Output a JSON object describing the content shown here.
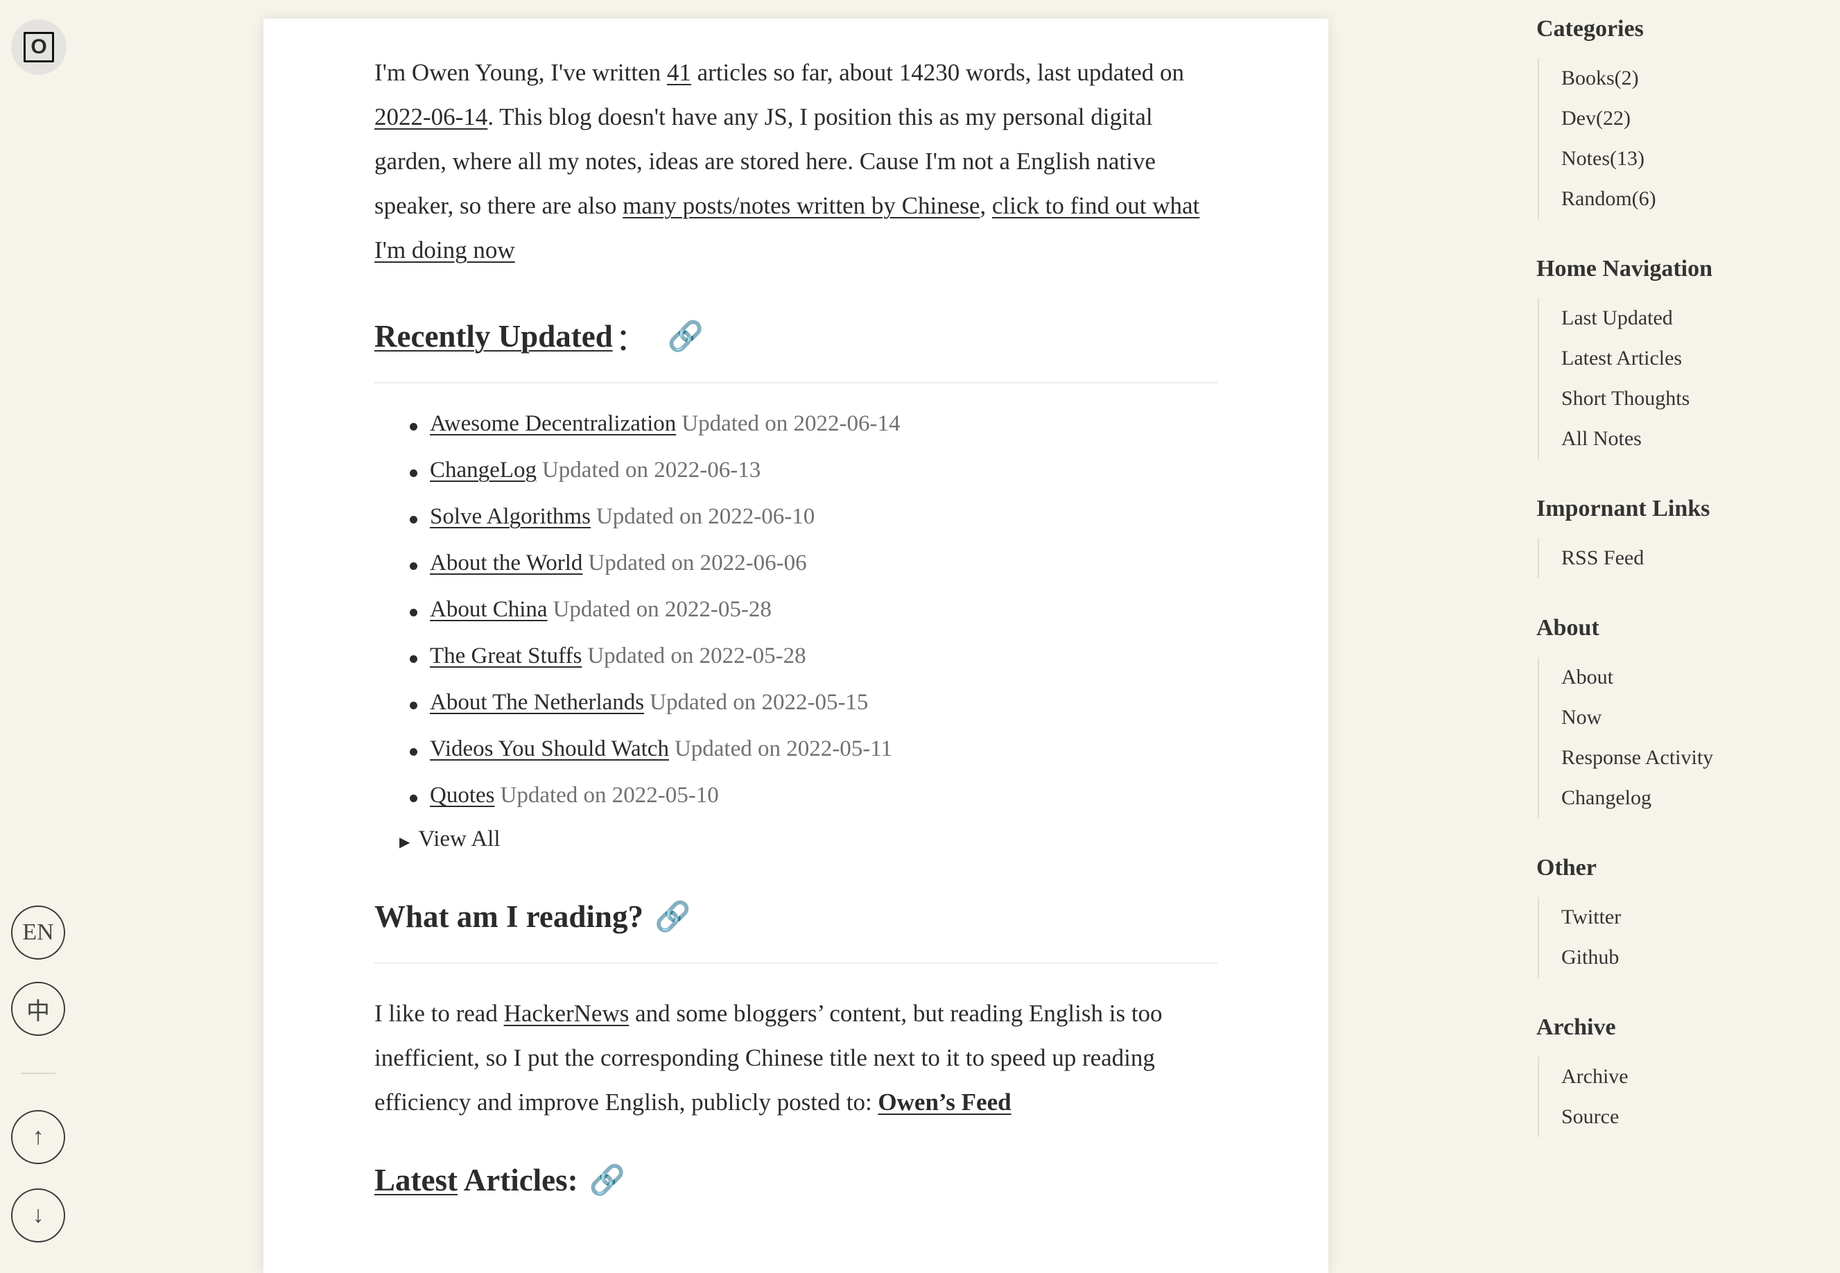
{
  "rail": {
    "lang_en": "EN",
    "lang_zh": "中",
    "up": "↑",
    "down": "↓",
    "logo_glyph": "O"
  },
  "intro": {
    "p1": "I'm Owen Young, I've written ",
    "articles_count": "41",
    "p2": " articles so far, about 14230 words, last updated on ",
    "last_updated": "2022-06-14",
    "p3": ". This blog doesn't have any JS, I position this as my personal digital garden, where all my notes, ideas are stored here. Cause I'm not a English native speaker, so there are also ",
    "chinese_link": "many posts/notes written by Chinese",
    "p4": ", ",
    "now_link": "click to find out what I'm doing now"
  },
  "recently_updated": {
    "title": "Recently Updated",
    "colon": "：",
    "link_icon": "🔗",
    "items": [
      {
        "title": "Awesome Decentralization",
        "date": "Updated on 2022-06-14"
      },
      {
        "title": "ChangeLog",
        "date": "Updated on 2022-06-13"
      },
      {
        "title": "Solve Algorithms",
        "date": "Updated on 2022-06-10"
      },
      {
        "title": "About the World",
        "date": "Updated on 2022-06-06"
      },
      {
        "title": "About China",
        "date": "Updated on 2022-05-28"
      },
      {
        "title": "The Great Stuffs",
        "date": "Updated on 2022-05-28"
      },
      {
        "title": "About The Netherlands",
        "date": "Updated on 2022-05-15"
      },
      {
        "title": "Videos You Should Watch",
        "date": "Updated on 2022-05-11"
      },
      {
        "title": "Quotes",
        "date": "Updated on 2022-05-10"
      }
    ],
    "view_all": "View All",
    "view_all_icon": "▶"
  },
  "reading": {
    "title": "What am I reading?",
    "link_icon": "🔗",
    "p1": "I like to read ",
    "hn_link": "HackerNews",
    "p2": " and some bloggers’ content, but reading English is too inefficient, so I put the corresponding Chinese title next to it to speed up reading efficiency and improve English, publicly posted to: ",
    "feed_link": "Owen’s Feed"
  },
  "latest": {
    "title_link": "Latest",
    "title_rest": " Articles:",
    "link_icon": "🔗"
  },
  "sidebar": {
    "groups": [
      {
        "title": "Categories",
        "items": [
          "Books(2)",
          "Dev(22)",
          "Notes(13)",
          "Random(6)"
        ]
      },
      {
        "title": "Home Navigation",
        "items": [
          "Last Updated",
          "Latest Articles",
          "Short Thoughts",
          "All Notes"
        ]
      },
      {
        "title": "Impornant Links",
        "items": [
          "RSS Feed"
        ]
      },
      {
        "title": "About",
        "items": [
          "About",
          "Now",
          "Response Activity",
          "Changelog"
        ]
      },
      {
        "title": "Other",
        "items": [
          "Twitter",
          "Github"
        ]
      },
      {
        "title": "Archive",
        "items": [
          "Archive",
          "Source"
        ]
      }
    ]
  }
}
